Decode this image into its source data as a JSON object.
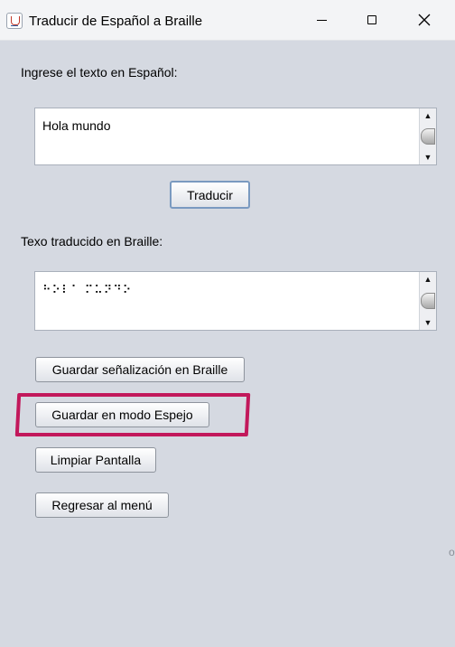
{
  "window": {
    "title": "Traducir de Español a Braille",
    "controls": {
      "minimize": "minimize",
      "maximize": "maximize",
      "close": "close"
    }
  },
  "input_section": {
    "label": "Ingrese el texto en Español:",
    "value": "Hola mundo"
  },
  "translate_button": "Traducir",
  "output_section": {
    "label": "Texo traducido en Braille:",
    "value": "⠓⠕⠇⠁ ⠍⠥⠝⠙⠕"
  },
  "buttons": {
    "save_braille": "Guardar señalización en Braille",
    "save_mirror": "Guardar en modo Espejo",
    "clear": "Limpiar Pantalla",
    "back": "Regresar al menú"
  },
  "scroll_arrows": {
    "up": "▲",
    "down": "▼"
  },
  "edge_glyph": "o",
  "colors": {
    "highlight": "#c2185b",
    "background": "#d5d9e1"
  }
}
